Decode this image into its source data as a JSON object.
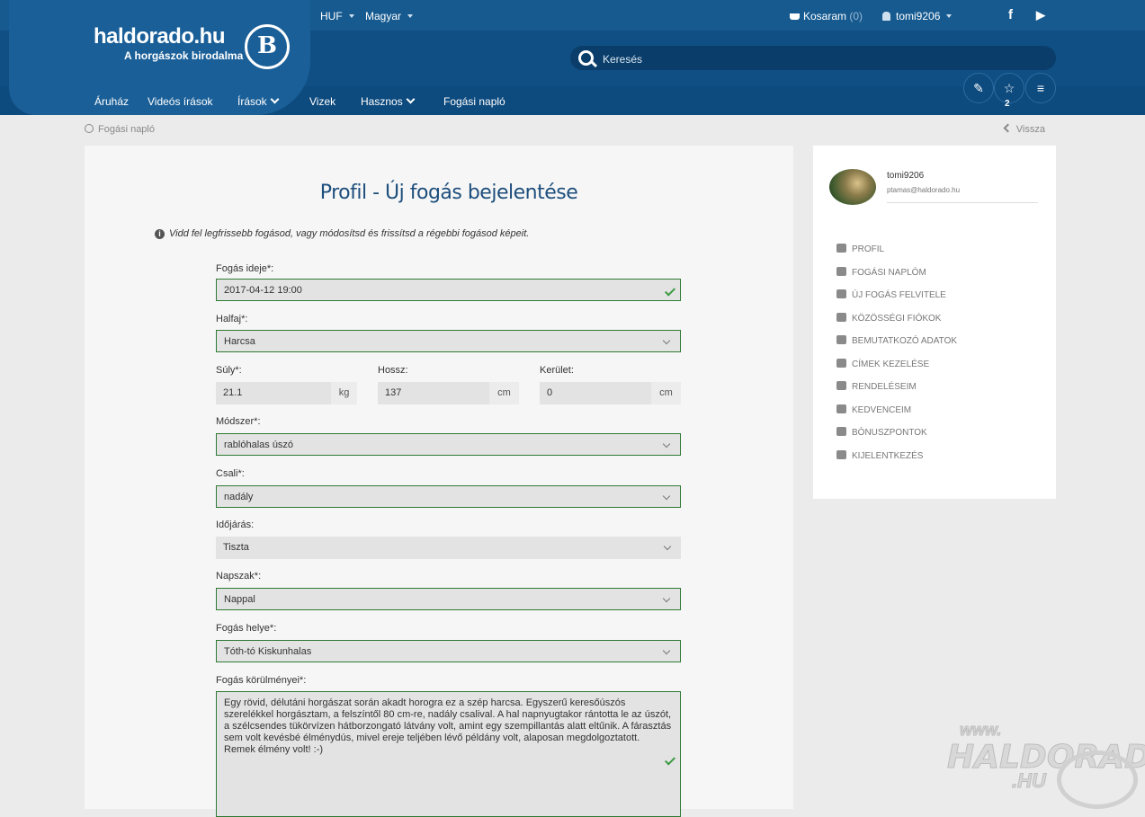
{
  "header": {
    "logo_title": "haldorado.hu",
    "logo_subtitle": "A horgászok birodalma",
    "currency": "HUF",
    "language": "Magyar",
    "cart_label": "Kosaram",
    "cart_count": "(0)",
    "username": "tomi9206",
    "social_facebook": "f",
    "social_youtube": "▶",
    "search_placeholder": "Keresés",
    "favorites_count": "2",
    "nav": [
      "Áruház",
      "Videós írások",
      "Írások",
      "Vizek",
      "Hasznos",
      "Fogási napló"
    ]
  },
  "breadcrumb": {
    "label": "Fogási napló",
    "back": "Vissza"
  },
  "form": {
    "title": "Profil - Új fogás bejelentése",
    "info": "Vidd fel legfrissebb fogásod, vagy módosítsd és frissítsd a régebbi fogásod képeit.",
    "date_label": "Fogás ideje*:",
    "date_value": "2017-04-12 19:00",
    "species_label": "Halfaj*:",
    "species_value": "Harcsa",
    "weight_label": "Súly*:",
    "weight_value": "21.1",
    "weight_unit": "kg",
    "length_label": "Hossz:",
    "length_value": "137",
    "length_unit": "cm",
    "girth_label": "Kerület:",
    "girth_value": "0",
    "girth_unit": "cm",
    "method_label": "Módszer*:",
    "method_value": "rablóhalas úszó",
    "bait_label": "Csali*:",
    "bait_value": "nadály",
    "weather_label": "Időjárás:",
    "weather_value": "Tiszta",
    "daytime_label": "Napszak*:",
    "daytime_value": "Nappal",
    "place_label": "Fogás helye*:",
    "place_value": "Tóth-tó Kiskunhalas",
    "circumstances_label": "Fogás körülményei*:",
    "circumstances_value": "Egy rövid, délutáni horgászat során akadt horogra ez a szép harcsa. Egyszerű keresőúszós szerelékkel horgásztam, a felszíntől 80 cm-re, nadály csalival. A hal napnyugtakor rántotta le az úszót, a szélcsendes tükörvízen hátborzongató látvány volt, amint egy szempillantás alatt eltűnik. A fárasztás sem volt kevésbé élménydús, mivel ereje teljében lévő példány volt, alaposan megdolgoztatott. Remek élmény volt! :-)"
  },
  "sidebar": {
    "username": "tomi9206",
    "email": "ptamas@haldorado.hu",
    "menu": [
      "PROFIL",
      "FOGÁSI NAPLÓM",
      "ÚJ FOGÁS FELVITELE",
      "KÖZÖSSÉGI FIÓKOK",
      "BEMUTATKOZÓ ADATOK",
      "CÍMEK KEZELÉSE",
      "RENDELÉSEIM",
      "KEDVENCEIM",
      "BÓNUSZPONTOK",
      "KIJELENTKEZÉS"
    ]
  },
  "watermark": {
    "www": "www.",
    "brand": "HALDORADO",
    "tld": ".HU"
  }
}
